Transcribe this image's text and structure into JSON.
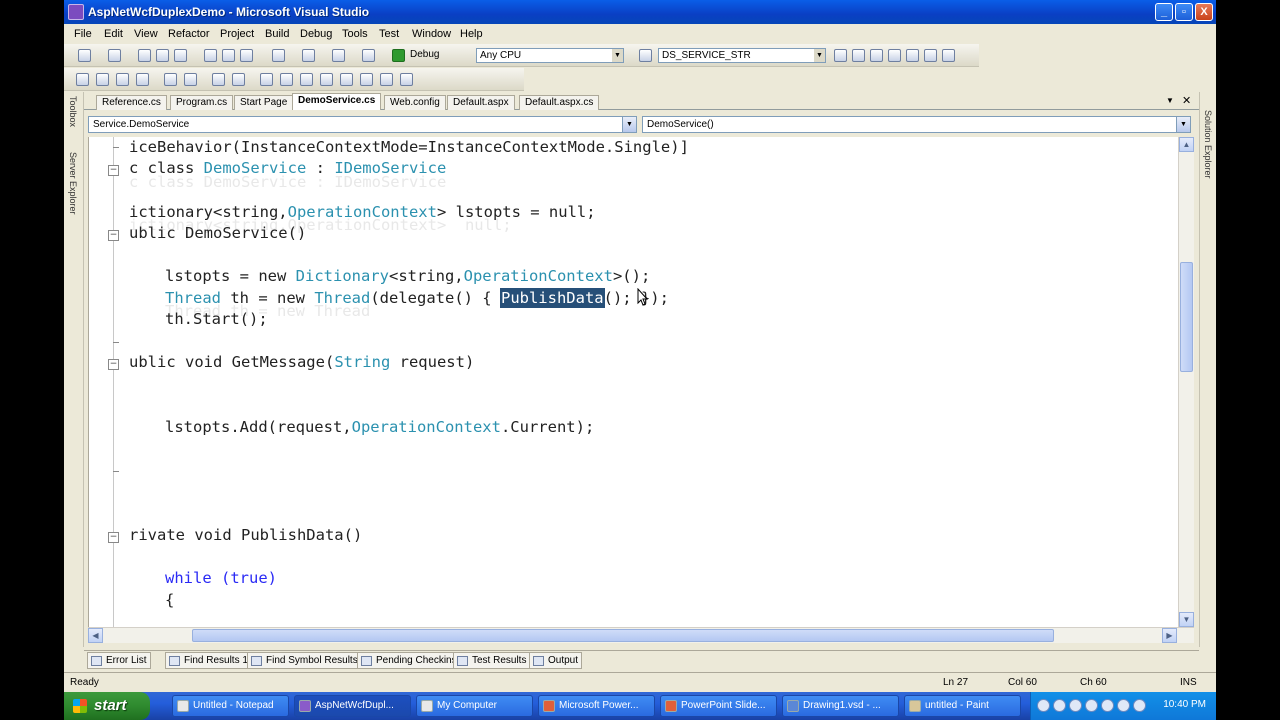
{
  "window": {
    "title": "AspNetWcfDuplexDemo - Microsoft Visual Studio",
    "minimize": "_",
    "restore": "▫",
    "close": "X"
  },
  "menu": [
    "File",
    "Edit",
    "View",
    "Refactor",
    "Project",
    "Build",
    "Debug",
    "Tools",
    "Test",
    "Window",
    "Help"
  ],
  "toolbar": {
    "config": "Debug",
    "platform": "Any CPU",
    "find_combo": "DS_SERVICE_STR"
  },
  "side_panels": {
    "toolbox": "Toolbox",
    "server_explorer": "Server Explorer",
    "solution_explorer": "Solution Explorer"
  },
  "doc_tabs": [
    "Reference.cs",
    "Program.cs",
    "Start Page",
    "DemoService.cs",
    "Web.config",
    "Default.aspx",
    "Default.aspx.cs"
  ],
  "active_tab": "DemoService.cs",
  "nav": {
    "type_combo": "Service.DemoService",
    "member_combo": "DemoService()"
  },
  "code": {
    "l1": "iceBehavior(InstanceContextMode=InstanceContextMode.Single)]",
    "l2a": "c class ",
    "l2b": "DemoService",
    "l2c": " : ",
    "l2d": "IDemoService",
    "l3a": "ictionary<string,",
    "l3b": "OperationContext",
    "l3c": "> lstopts = null;",
    "l4": "ublic DemoService()",
    "l5a": "lstopts = new ",
    "l5b": "Dictionary",
    "l5c": "<string,",
    "l5d": "OperationContext",
    "l5e": ">();",
    "l6a": "Thread",
    "l6b": " th = new ",
    "l6c": "Thread",
    "l6d": "(delegate() { ",
    "l6e": "PublishData",
    "l6f": "(); });",
    "l7": "th.Start();",
    "l8a": "ublic void GetMessage(",
    "l8b": "String",
    "l8c": " request)",
    "l9a": "lstopts.Add(request,",
    "l9b": "OperationContext",
    "l9c": ".Current);",
    "l10": "rivate void PublishData()",
    "l11": "while (true)",
    "l12": "{"
  },
  "tool_tabs": [
    "Error List",
    "Find Results 1",
    "Find Symbol Results",
    "Pending Checkins",
    "Test Results",
    "Output"
  ],
  "status": {
    "ready": "Ready",
    "line": "Ln 27",
    "col": "Col 60",
    "ch": "Ch 60",
    "mode": "INS"
  },
  "taskbar": {
    "start": "start",
    "tasks": [
      "Untitled - Notepad",
      "AspNetWcfDupl...",
      "My Computer",
      "Microsoft Power...",
      "PowerPoint Slide...",
      "Drawing1.vsd - ...",
      "untitled - Paint"
    ],
    "clock": "10:40 PM"
  }
}
